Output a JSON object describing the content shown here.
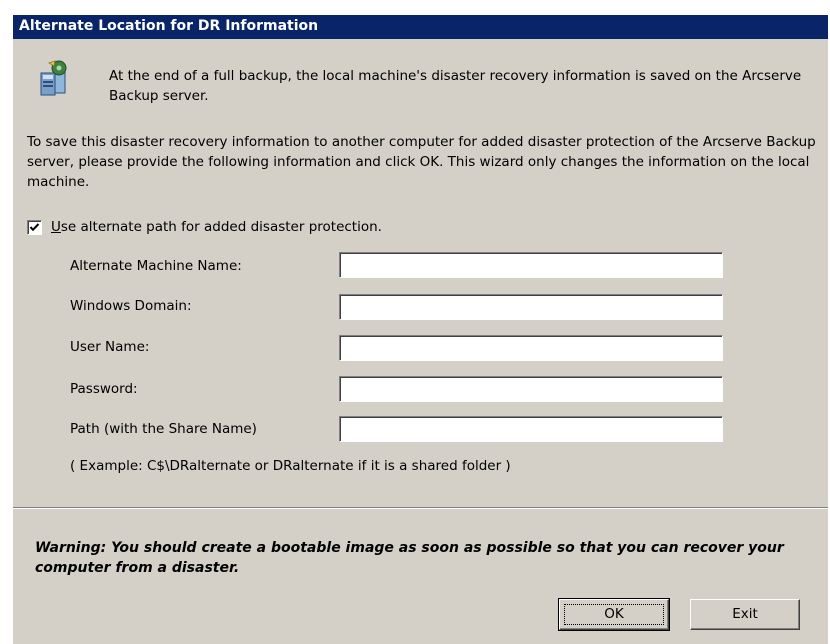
{
  "window": {
    "title": "Alternate Location for DR Information"
  },
  "intro": {
    "text": "At the end of a full backup, the local machine's disaster recovery information is saved on the Arcserve Backup server."
  },
  "description": {
    "text": "To save this disaster recovery information to another computer for added disaster protection of the Arcserve Backup server, please provide the following information and click OK. This wizard only changes the information on the local machine."
  },
  "checkbox": {
    "mnemonic": "U",
    "label_rest": "se alternate path for added disaster protection.",
    "checked": true
  },
  "fields": {
    "machine_name": {
      "label": "Alternate Machine Name:",
      "value": ""
    },
    "domain": {
      "label": "Windows Domain:",
      "value": ""
    },
    "user_name": {
      "label": "User Name:",
      "value": ""
    },
    "password": {
      "label": "Password:",
      "value": ""
    },
    "path": {
      "label": "Path (with the Share Name)",
      "value": ""
    }
  },
  "example": {
    "text": "( Example: C$\\DRalternate or DRalternate if it is a shared folder )"
  },
  "warning": {
    "text": "Warning: You should create a bootable image as soon as possible so that you can recover your computer from a disaster."
  },
  "buttons": {
    "ok": "OK",
    "exit": "Exit"
  },
  "colors": {
    "titlebar": "#0a246a",
    "dialog_bg": "#d4d0c8"
  },
  "icons": {
    "app": "backup-server-icon",
    "check": "checkmark-icon"
  }
}
